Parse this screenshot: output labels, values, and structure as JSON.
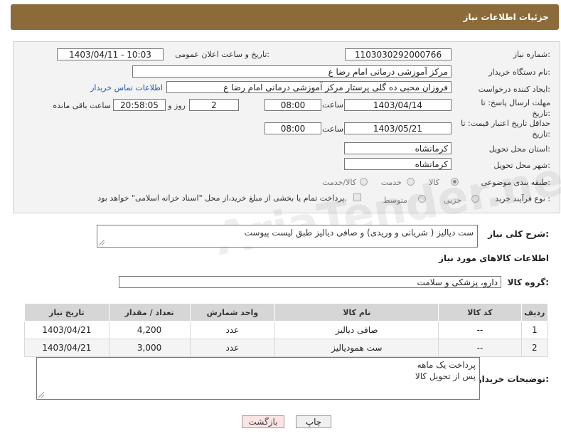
{
  "header": {
    "title": "جزئیات اطلاعات نیاز"
  },
  "form": {
    "need_number_label": "شماره نیاز:",
    "need_number": "1103030292000766",
    "announce_label": "تاریخ و ساعت اعلان عمومی:",
    "announce_value": "1403/04/11 - 10:03",
    "buyer_org_label": "نام دستگاه خریدار:",
    "buyer_org": "مرکز آموزشی  درمانی امام رضا  ع",
    "creator_label": "ایجاد کننده درخواست:",
    "creator": "فروزان محبی ده گلی پرستار مرکز آموزشی  درمانی امام رضا  ع",
    "contact_link": "اطلاعات تماس خریدار",
    "deadline_label": "مهلت ارسال پاسخ: تا تاریخ:",
    "deadline_date": "1403/04/14",
    "time_label": "ساعت",
    "deadline_time": "08:00",
    "days_value": "2",
    "days_label": "روز و",
    "remaining_time": "20:58:05",
    "remaining_label": "ساعت باقی مانده",
    "validity_label": "حداقل تاریخ اعتبار قیمت: تا تاریخ:",
    "validity_date": "1403/05/21",
    "validity_time": "08:00",
    "province_label": "استان محل تحویل:",
    "province": "کرمانشاه",
    "city_label": "شهر محل تحویل:",
    "city": "کرمانشاه",
    "category_label": "طبقه بندی موضوعی:",
    "category_options": [
      "کالا",
      "خدمت",
      "کالا/خدمت"
    ],
    "process_label": "نوع فرآیند خرید :",
    "process_options": [
      "جزیی",
      "متوسط"
    ],
    "treasury_note": "پرداخت تمام یا بخشی از مبلغ خرید،از محل \"اسناد خزانه اسلامی\" خواهد بود."
  },
  "summary": {
    "label": "شرح کلی نیاز:",
    "text": "ست دیالیز  (  شریانی و وریدی)    و  صافی دیالیز طبق لیست پیوست"
  },
  "goods_section": {
    "title": "اطلاعات کالاهای مورد نیاز",
    "group_label": "گروه کالا:",
    "group_value": "دارو، پزشکی و سلامت"
  },
  "table": {
    "headers": [
      "ردیف",
      "کد کالا",
      "نام کالا",
      "واحد شمارش",
      "تعداد / مقدار",
      "تاریخ نیاز"
    ],
    "rows": [
      [
        "1",
        "--",
        "صافی دیالیز",
        "عدد",
        "4,200",
        "1403/04/21"
      ],
      [
        "2",
        "--",
        "ست همودیالیز",
        "عدد",
        "3,000",
        "1403/04/21"
      ]
    ]
  },
  "buyer_notes": {
    "label": "توضیحات خریدار:",
    "line1": "پرداخت یک ماهه",
    "line2": "پس از تحویل  کالا"
  },
  "buttons": {
    "print": "چاپ",
    "back": "بازگشت"
  },
  "watermark": "AriaTender.net"
}
